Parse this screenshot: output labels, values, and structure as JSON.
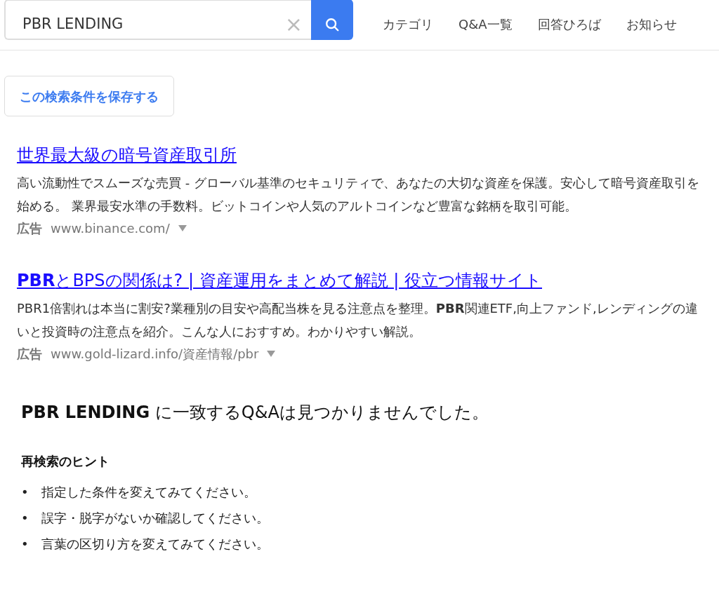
{
  "search": {
    "value": "PBR LENDING",
    "clear": "×"
  },
  "nav": [
    "カテゴリ",
    "Q&A一覧",
    "回答ひろば",
    "お知らせ"
  ],
  "save_button": "この検索条件を保存する",
  "ads": [
    {
      "title": "世界最大級の暗号資産取引所",
      "description": "高い流動性でスムーズな売買 - グローバル基準のセキュリティで、あなたの大切な資産を保護。安心して暗号資産取引を始める。 業界最安水準の手数料。ビットコインや人気のアルトコインなど豊富な銘柄を取引可能。",
      "label": "広告",
      "url": "www.binance.com/"
    },
    {
      "title": "**PBR**とBPSの関係は? | 資産運用をまとめて解説 | 役立つ情報サイト",
      "description": "PBR1倍割れは本当に割安?業種別の目安や高配当株を見る注意点を整理。**PBR**関連ETF,向上ファンド,レンディングの違いと投資時の注意点を紹介。こんな人におすすめ。わかりやすい解説。",
      "label": "広告",
      "url": "www.gold-lizard.info/資産情報/pbr"
    }
  ],
  "no_result": "**PBR LENDING** に一致するQ&Aは見つかりませんでした。",
  "hints": {
    "title": "再検索のヒント",
    "items": [
      {
        "bullet": "•",
        "text": "指定した条件を変えてみてください。"
      },
      {
        "bullet": "•",
        "text": "誤字・脱字がないか確認してください。"
      },
      {
        "bullet": "•",
        "text": "言葉の区切り方を変えてみてください。"
      }
    ]
  }
}
